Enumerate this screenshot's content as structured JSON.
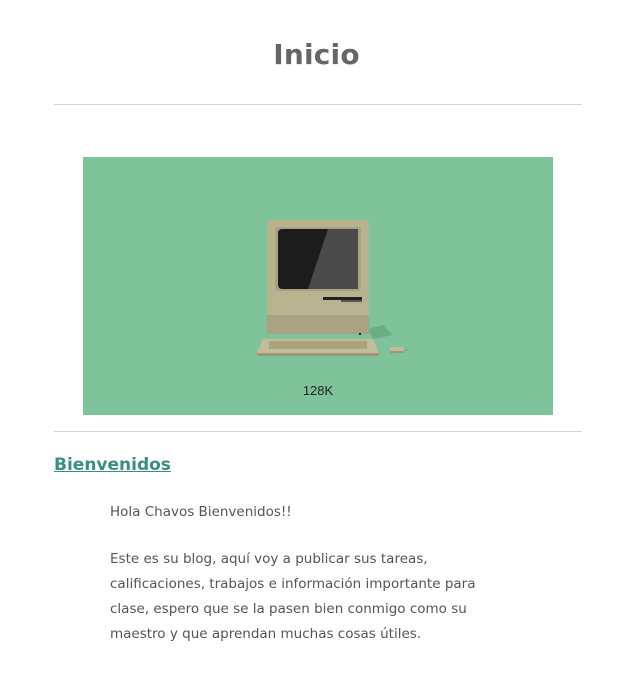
{
  "page": {
    "title": "Inicio"
  },
  "hero": {
    "caption": "128K",
    "icon": "macintosh-computer-illustration",
    "background_color": "#7fc39a"
  },
  "post": {
    "title": "Bienvenidos",
    "paragraphs": [
      "Hola Chavos Bienvenidos!!",
      "Este es su blog, aquí voy a publicar sus tareas, calificaciones, trabajos e información importante para clase, espero que se la pasen bien conmigo como su maestro y que aprendan muchas cosas útiles."
    ]
  },
  "colors": {
    "link": "#3a8f80",
    "text": "#555555",
    "divider": "#d4d4d4"
  }
}
